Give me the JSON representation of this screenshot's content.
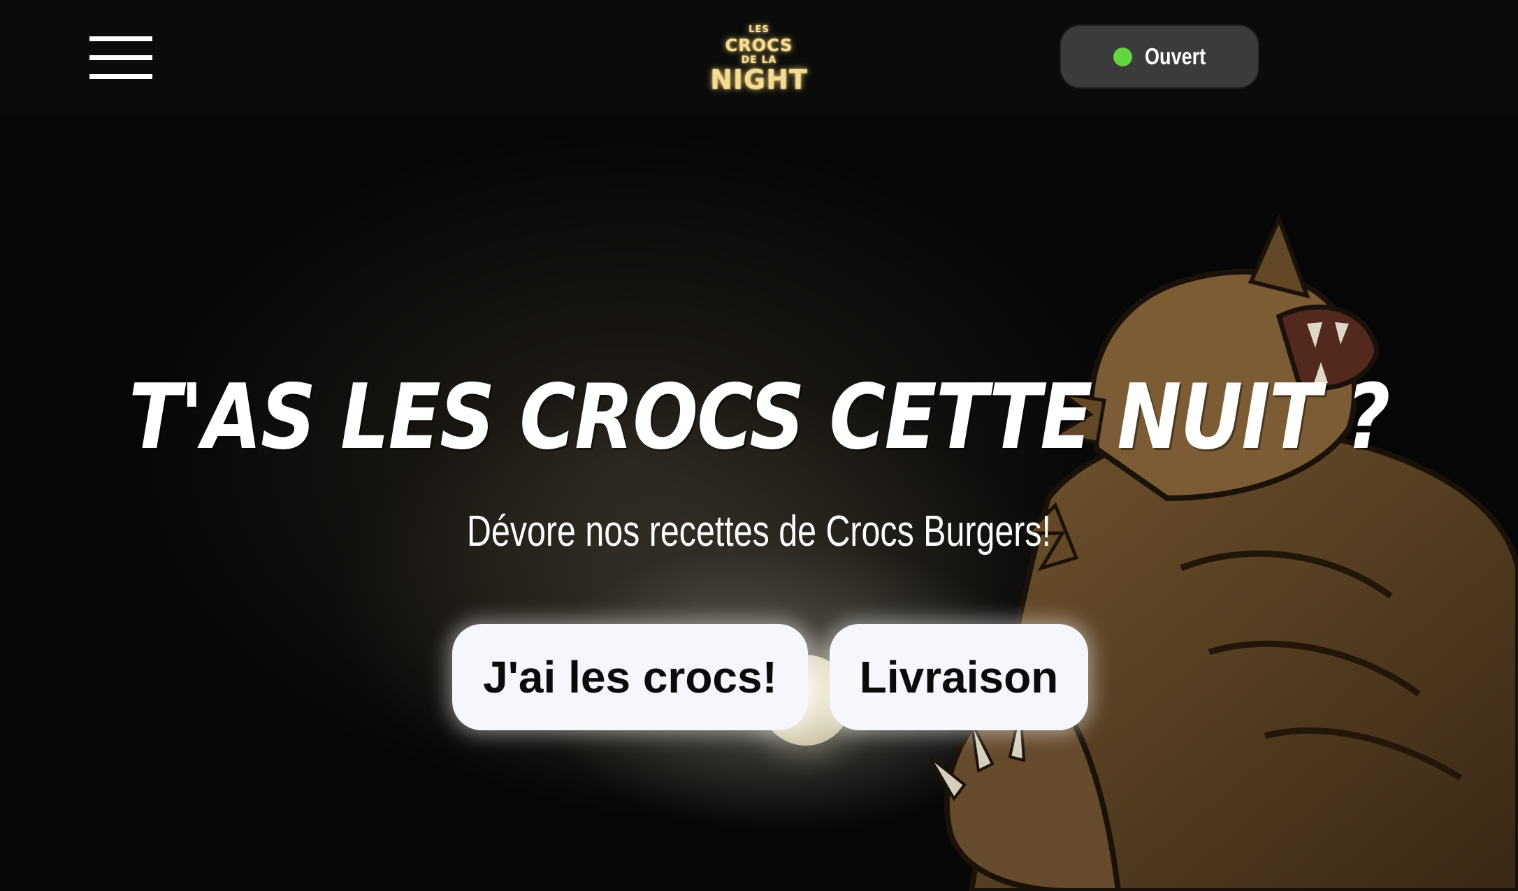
{
  "header": {
    "menu_label": "Menu",
    "logo": {
      "line1": "LES",
      "line2": "CROCS",
      "line3": "DE LA",
      "line4": "NIGHT"
    },
    "status": {
      "label": "Ouvert",
      "dot_color": "#63d53e"
    }
  },
  "hero": {
    "title": "T'as les crocs cette nuit ?",
    "subtitle": "Dévore nos recettes de Crocs Burgers!",
    "buttons": [
      {
        "label": "J'ai les crocs!"
      },
      {
        "label": "Livraison"
      }
    ]
  },
  "colors": {
    "header_bg": "#0b0b0b",
    "logo_gold": "#f3dd96",
    "pill_bg": "#3b3b3b",
    "button_bg": "#f6f6fd",
    "text_white": "#ffffff"
  }
}
